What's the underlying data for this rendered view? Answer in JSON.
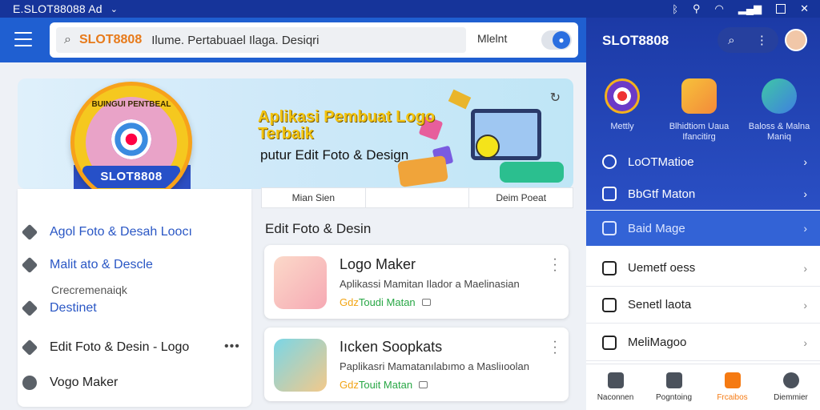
{
  "status_bar": {
    "title": "E.SLOT88088 Ad",
    "chevron": "⌄",
    "icons": [
      "bluetooth-icon",
      "signal-icon",
      "wifi-icon",
      "bars-icon",
      "square-icon",
      "close-icon"
    ]
  },
  "app_bar": {
    "brand": "SLOT8808",
    "query": "Ilume. Pertabuael Ilaga. Desiqri",
    "side_label": "Mlelnt"
  },
  "banner": {
    "title": "Aplikasi Pembuat Logo Terbaik",
    "subtitle": "putur Edit Foto & Design",
    "badge_arc": "BUINGUI PENTBEAL",
    "badge_ribbon": "SLOT8808"
  },
  "menu": {
    "items": [
      {
        "label": "Agol Foto & Desah Loocı"
      },
      {
        "label": "Malit ato & Descle"
      },
      {
        "label": "Destinet"
      },
      {
        "label": "Edit Foto & Desin - Logo"
      },
      {
        "label": "Vogo Maker"
      }
    ],
    "sub_label": "Crecremenaiqk",
    "more": "•••"
  },
  "tabs": [
    "Mian Sien",
    "",
    "Deim Poeat"
  ],
  "section_title": "Edit Foto & Desin",
  "apps": [
    {
      "name": "Logo Maker",
      "desc": "Aplikassi Mamitan Ilador a Maelinasian",
      "meta_g": "Gdz",
      "meta_rest": " Toudi Matan"
    },
    {
      "name": "Iıcken Soopkats",
      "desc": "Paplikasri Mamatanılabımo a Masliıoolan",
      "meta_g": "Gdz",
      "meta_rest": " Touit Matan"
    }
  ],
  "drawer": {
    "title": "SLOT8808",
    "apps": [
      {
        "label": "Mettly"
      },
      {
        "label": "Blhidtiom Uaua Ifancitirg"
      },
      {
        "label": "Baloss & Malna Maniq"
      }
    ],
    "rows": [
      {
        "label": "LoOTMatioe"
      },
      {
        "label": "BbGtf Maton"
      },
      {
        "label": "Baid Mage"
      },
      {
        "label": "Uemetf oess"
      },
      {
        "label": "Senetl laota"
      },
      {
        "label": "MeliMagoo"
      }
    ],
    "nav": [
      {
        "label": "Naconnen"
      },
      {
        "label": "Pogntoing"
      },
      {
        "label": "Frcaibos"
      },
      {
        "label": "Diemmier"
      }
    ]
  },
  "colors": {
    "status_bar": "#16349a",
    "app_bar": "#1f5fd1",
    "brand_orange": "#e77a1a",
    "accent_green": "#28a745",
    "drawer_top": "#1c3aa6",
    "drawer_selected": "#3363d6",
    "nav_active": "#f57a12"
  }
}
